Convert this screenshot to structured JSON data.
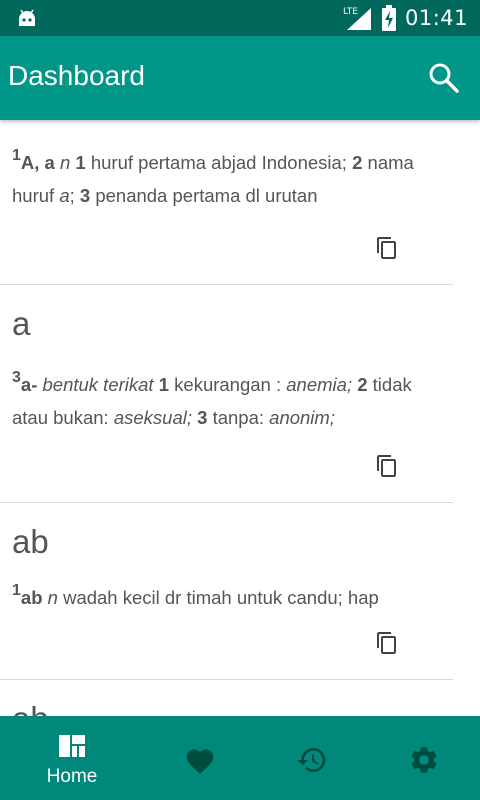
{
  "status_bar": {
    "network": "LTE",
    "time": "01:41"
  },
  "app_bar": {
    "title": "Dashboard",
    "search_icon": "search-icon"
  },
  "entries": [
    {
      "title": "",
      "sup": "1",
      "head": "A, a",
      "pos": "n",
      "n1": "1",
      "d1": "huruf pertama abjad Indonesia;",
      "n2": "2",
      "d2a": "nama huruf",
      "d2b": "a",
      "d2c": ";",
      "n3": "3",
      "d3": "penanda pertama dl urutan"
    },
    {
      "title": "a",
      "sup": "3",
      "head": "a-",
      "t1": "bentuk terikat",
      "n1": "1",
      "d1": "kekurangan :",
      "e1": "anemia;",
      "n2": "2",
      "d2": "tidak atau bukan:",
      "e2": "aseksual;",
      "n3": "3",
      "d3": "tanpa:",
      "e3": "anonim;"
    },
    {
      "title": "ab",
      "sup": "1",
      "head": "ab",
      "pos": "n",
      "d1": "wadah kecil dr timah untuk candu; hap"
    },
    {
      "title": "ab"
    }
  ],
  "bottom_nav": {
    "items": [
      {
        "label": "Home",
        "icon": "dashboard-icon",
        "active": true
      },
      {
        "label": "",
        "icon": "heart-icon",
        "active": false
      },
      {
        "label": "",
        "icon": "history-icon",
        "active": false
      },
      {
        "label": "",
        "icon": "gear-icon",
        "active": false
      }
    ]
  },
  "colors": {
    "status_bar": "#00695c",
    "app_bar": "#009688",
    "bottom_nav": "#00897b",
    "text": "#555555",
    "divider": "#d9d9d9"
  }
}
